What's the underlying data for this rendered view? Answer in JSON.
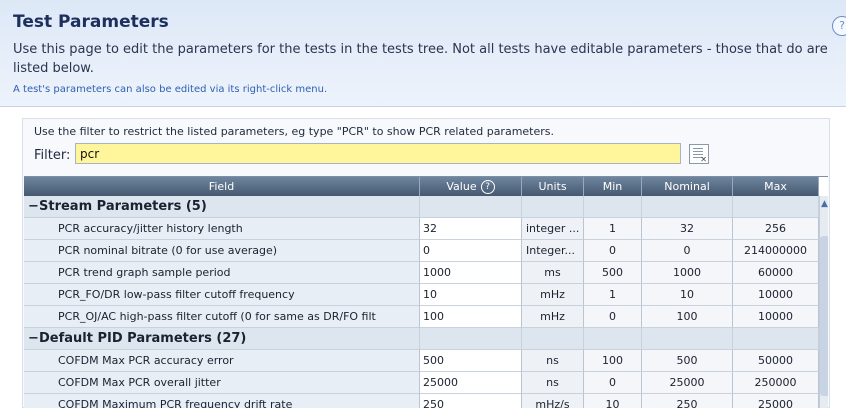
{
  "page": {
    "title": "Test Parameters",
    "description": "Use this page to edit the parameters for the tests in the tests tree. Not all tests have editable parameters - those that do are listed below.",
    "hint": "A test's parameters can also be edited via its right-click menu."
  },
  "filter": {
    "help": "Use the filter to restrict the listed parameters, eg type \"PCR\" to show PCR related parameters.",
    "label": "Filter:",
    "value": "pcr"
  },
  "columns": {
    "field": "Field",
    "value": "Value",
    "units": "Units",
    "min": "Min",
    "nominal": "Nominal",
    "max": "Max"
  },
  "groups": [
    {
      "name": "Stream Parameters (5)",
      "toggle": "−",
      "rows": [
        {
          "field": "PCR accuracy/jitter history length",
          "value": "32",
          "units": "integer ...",
          "min": "1",
          "nominal": "32",
          "max": "256"
        },
        {
          "field": "PCR nominal bitrate (0 for use average)",
          "value": "0",
          "units": "Integer...",
          "min": "0",
          "nominal": "0",
          "max": "214000000"
        },
        {
          "field": "PCR trend graph sample period",
          "value": "1000",
          "units": "ms",
          "min": "500",
          "nominal": "1000",
          "max": "60000"
        },
        {
          "field": "PCR_FO/DR low-pass filter cutoff frequency",
          "value": "10",
          "units": "mHz",
          "min": "1",
          "nominal": "10",
          "max": "10000"
        },
        {
          "field": "PCR_OJ/AC high-pass filter cutoff (0 for same as DR/FO filt",
          "value": "100",
          "units": "mHz",
          "min": "0",
          "nominal": "100",
          "max": "10000"
        }
      ]
    },
    {
      "name": "Default PID Parameters (27)",
      "toggle": "−",
      "rows": [
        {
          "field": "COFDM Max PCR accuracy error",
          "value": "500",
          "units": "ns",
          "min": "100",
          "nominal": "500",
          "max": "50000"
        },
        {
          "field": "COFDM Max PCR overall jitter",
          "value": "25000",
          "units": "ns",
          "min": "0",
          "nominal": "25000",
          "max": "250000"
        },
        {
          "field": "COFDM Maximum PCR frequency drift rate",
          "value": "250",
          "units": "mHz/s",
          "min": "10",
          "nominal": "250",
          "max": "25000"
        }
      ]
    }
  ],
  "colors": {
    "header_bg": "#dde8f7",
    "filter_bg": "#fff59a",
    "grid_header": "#566b84",
    "field_bg": "#e7eef6"
  }
}
